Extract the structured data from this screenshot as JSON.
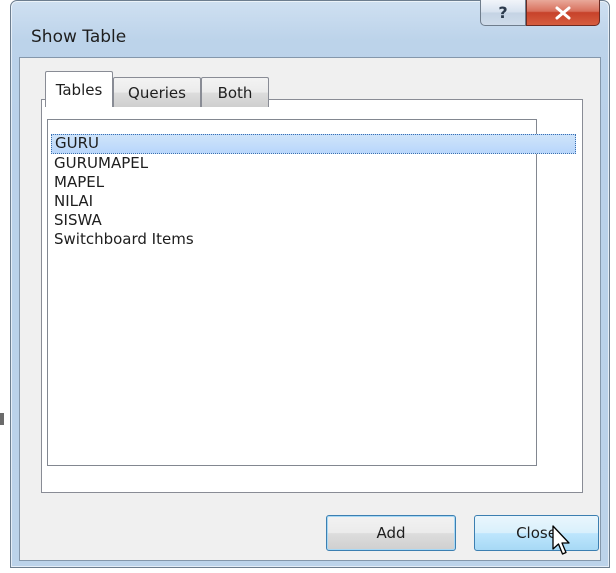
{
  "window": {
    "title": "Show Table",
    "help_label": "?",
    "close_icon": "close-x-icon"
  },
  "tabs": [
    {
      "label": "Tables",
      "active": true
    },
    {
      "label": "Queries",
      "active": false
    },
    {
      "label": "Both",
      "active": false
    }
  ],
  "list": {
    "items": [
      "GURU",
      "GURUMAPEL",
      "MAPEL",
      "NILAI",
      "SISWA",
      "Switchboard Items"
    ],
    "selected_index": 0
  },
  "buttons": {
    "add_label": "Add",
    "close_label": "Close"
  },
  "colors": {
    "selection": "#b8d6fb",
    "title_close_red": "#c7422a",
    "window_frame": "#b9d1ea"
  }
}
